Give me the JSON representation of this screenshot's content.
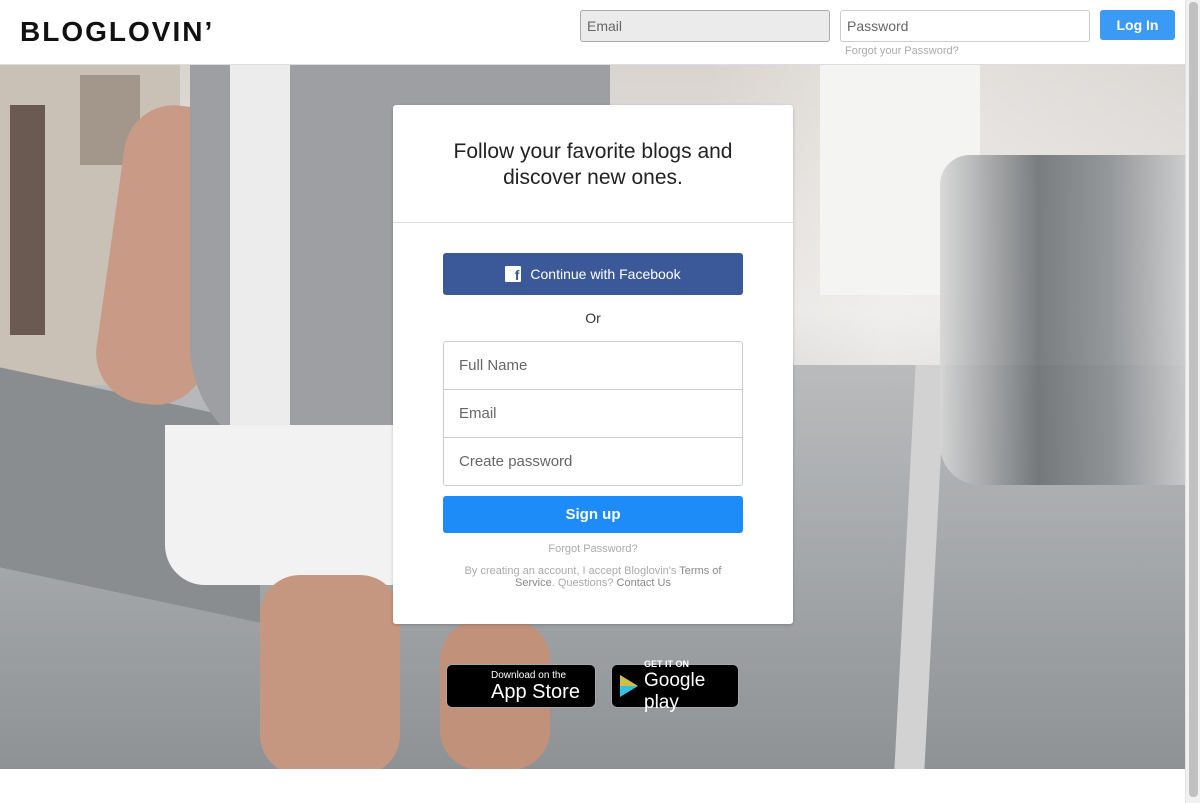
{
  "header": {
    "logo": "BLOGLOVIN’",
    "email_placeholder": "Email",
    "password_placeholder": "Password",
    "login_label": "Log In",
    "forgot_label": "Forgot your Password?"
  },
  "signup_card": {
    "title": "Follow your favorite blogs and discover new ones.",
    "facebook_button": "Continue with Facebook",
    "facebook_icon": "f",
    "or_label": "Or",
    "full_name_placeholder": "Full Name",
    "email_placeholder": "Email",
    "password_placeholder": "Create password",
    "signup_label": "Sign up",
    "forgot_label": "Forgot Password?",
    "terms_prefix": "By creating an account, I accept Bloglovin's ",
    "terms_link": "Terms of Service",
    "terms_mid": ". Questions? ",
    "contact_link": "Contact Us"
  },
  "badges": {
    "appstore_icon": "",
    "appstore_small": "Download on the",
    "appstore_big": "App Store",
    "googleplay_small": "GET IT ON",
    "googleplay_big": "Google play"
  },
  "colors": {
    "facebook": "#3b5998",
    "signup": "#1d8bf8",
    "login": "#3a9af5"
  }
}
